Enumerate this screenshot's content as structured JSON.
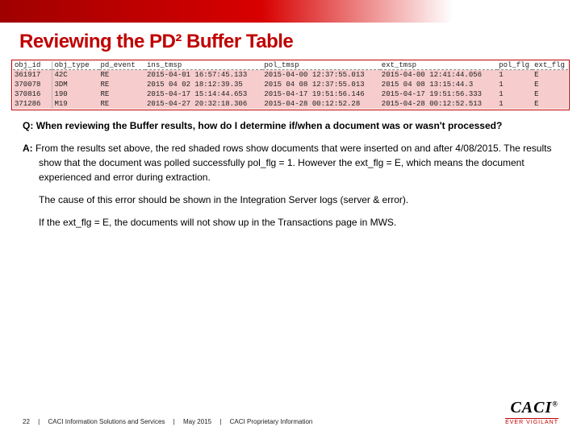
{
  "title": "Reviewing the PD² Buffer Table",
  "table": {
    "headers": {
      "obj_id": "obj_id",
      "obj_type": "obj_type",
      "pd_event": "pd_event",
      "ins_tmsp": "ins_tmsp",
      "pol_tmsp": "pol_tmsp",
      "ext_tmsp": "ext_tmsp",
      "pol_flg": "pol_flg",
      "ext_flg": "ext_flg"
    },
    "rows": [
      {
        "obj_id": "361917",
        "obj_type": "42C",
        "pd_event": "RE",
        "ins_tmsp": "2015-04-01 16:57:45.133",
        "pol_tmsp": "2015-04-00 12:37:55.013",
        "ext_tmsp": "2015-04-00 12:41:44.056",
        "pol_flg": "1",
        "ext_flg": "E"
      },
      {
        "obj_id": "370078",
        "obj_type": "3DM",
        "pd_event": "RE",
        "ins_tmsp": "2015 04 02 18:12:39.35",
        "pol_tmsp": "2015 04 08 12:37:55.013",
        "ext_tmsp": "2015 04 08 13:15:44.3",
        "pol_flg": "1",
        "ext_flg": "E"
      },
      {
        "obj_id": "370816",
        "obj_type": "190",
        "pd_event": "RE",
        "ins_tmsp": "2015-04-17 15:14:44.653",
        "pol_tmsp": "2015-04-17 19:51:56.146",
        "ext_tmsp": "2015-04-17 19:51:56.333",
        "pol_flg": "1",
        "ext_flg": "E"
      },
      {
        "obj_id": "371286",
        "obj_type": "M19",
        "pd_event": "RE",
        "ins_tmsp": "2015-04-27 20:32:18.306",
        "pol_tmsp": "2015-04-28 00:12:52.28",
        "ext_tmsp": "2015-04-28 00:12:52.513",
        "pol_flg": "1",
        "ext_flg": "E"
      }
    ]
  },
  "qa": {
    "q_label": "Q:",
    "q_text": "When reviewing the Buffer results, how do I determine if/when a document was or wasn't processed?",
    "a_label": "A:",
    "a_p1": "From the results set above, the red shaded rows show documents that were inserted on and after 4/08/2015.  The results show that the document was polled successfully pol_flg = 1.  However the  ext_flg = E, which means the document experienced and error during extraction.",
    "a_p2": "The cause of this error should be shown in the Integration Server logs (server & error).",
    "a_p3": "If the ext_flg = E, the documents will not show up in the Transactions page in MWS."
  },
  "footer": {
    "page": "22",
    "org": "CACI Information Solutions and Services",
    "date": "May 2015",
    "prop": "CACI Proprietary Information",
    "sep": "|",
    "brand": "CACI",
    "reg": "®",
    "tag": "EVER VIGILANT"
  }
}
